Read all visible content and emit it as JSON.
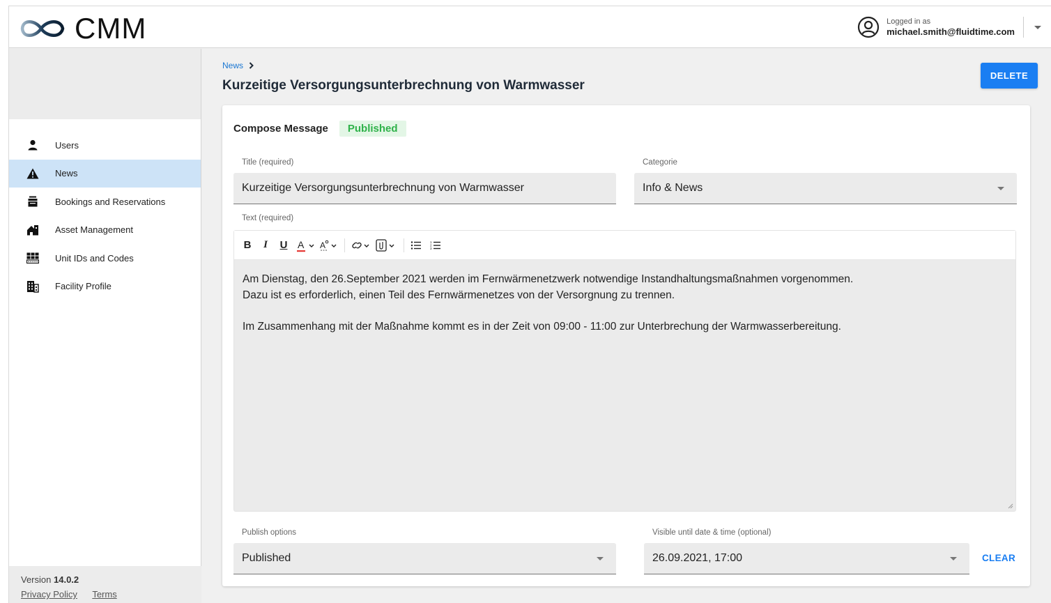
{
  "app": {
    "brand": "CMM",
    "user_caption": "Logged in as",
    "user_email": "michael.smith@fluidtime.com"
  },
  "sidebar": {
    "items": [
      {
        "label": "Users",
        "icon": "person-icon",
        "active": false
      },
      {
        "label": "News",
        "icon": "warning-icon",
        "active": true
      },
      {
        "label": "Bookings and Reservations",
        "icon": "bookings-icon",
        "active": false
      },
      {
        "label": "Asset Management",
        "icon": "asset-house-icon",
        "active": false
      },
      {
        "label": "Unit IDs and Codes",
        "icon": "keypad-icon",
        "active": false
      },
      {
        "label": "Facility Profile",
        "icon": "building-icon",
        "active": false
      }
    ],
    "version_label": "Version",
    "version_number": "14.0.2",
    "privacy_link": "Privacy Policy",
    "terms_link": "Terms"
  },
  "main": {
    "breadcrumb": "News",
    "title": "Kurzeitige Versorgungsunterbrechnung von Warmwasser",
    "delete_label": "DELETE"
  },
  "form": {
    "compose_title": "Compose Message",
    "status_badge": "Published",
    "title_label": "Title (required)",
    "title_value": "Kurzeitige Versorgungsunterbrechnung von Warmwasser",
    "category_label": "Categorie",
    "category_value": "Info & News",
    "text_label": "Text (required)",
    "text_lines": [
      "Am Dienstag, den 26.September 2021 werden im Fernwärmenetzwerk notwendige Instandhaltungsmaßnahmen vorgenommen.",
      "Dazu ist es erforderlich, einen Teil des Fernwärmenetzes von der Versorgnung zu trennen.",
      "",
      "Im Zusammenhang mit der Maßnahme kommt es in der Zeit von 09:00 - 11:00 zur Unterbrechung der Warmwasserbereitung."
    ],
    "toolbar": [
      "bold-icon",
      "italic-icon",
      "underline-icon",
      "text-color-icon",
      "highlight-icon",
      "link-icon",
      "attachment-icon",
      "bullet-list-icon",
      "numbered-list-icon"
    ],
    "publish_label": "Publish options",
    "publish_value": "Published",
    "visible_label": "Visible until date & time (optional)",
    "visible_value": "26.09.2021, 17:00",
    "clear_label": "CLEAR"
  },
  "colors": {
    "accent": "#1a7ef2",
    "active_nav": "#cde3f7",
    "badge_bg": "#e3f6e6",
    "badge_text": "#2fb24a",
    "text_color_underline": "#e53935"
  }
}
